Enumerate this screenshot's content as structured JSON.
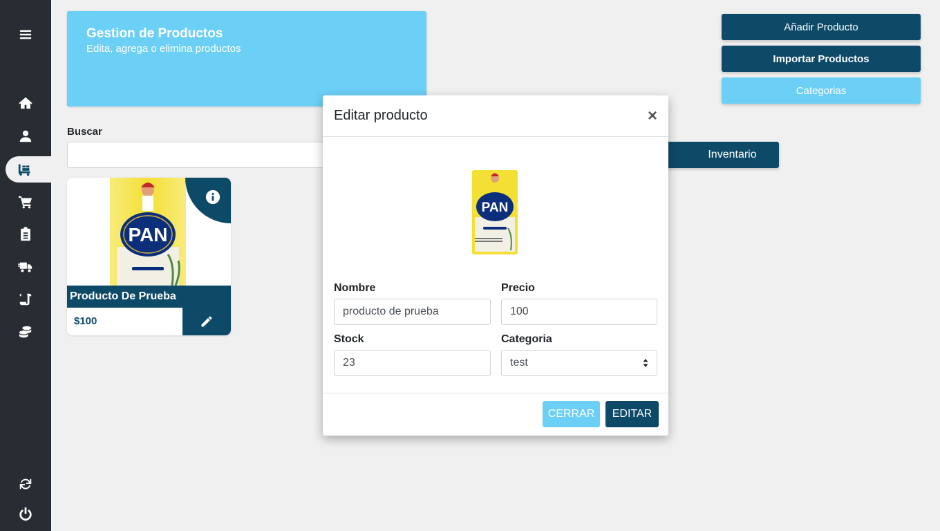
{
  "sidebar": {
    "icons": [
      "menu-icon",
      "home-icon",
      "user-icon",
      "dolly-icon",
      "cart-icon",
      "clipboard-icon",
      "truck-icon",
      "scroll-icon",
      "coins-icon",
      "sync-icon",
      "power-icon"
    ],
    "active": "dolly-icon"
  },
  "header": {
    "title": "Gestion de Productos",
    "subtitle": "Edita, agrega o elimina productos"
  },
  "actions": {
    "add_label": "Añadir Producto",
    "import_label": "Importar Productos",
    "categories_label": "Categorias"
  },
  "search": {
    "label": "Buscar",
    "value": "",
    "inventory_label": "Inventario"
  },
  "products": [
    {
      "name": "Producto De Prueba",
      "price": "$100"
    }
  ],
  "modal": {
    "title": "Editar producto",
    "close": "×",
    "fields": {
      "nombre_label": "Nombre",
      "nombre_value": "producto de prueba",
      "precio_label": "Precio",
      "precio_value": "100",
      "stock_label": "Stock",
      "stock_value": "23",
      "categoria_label": "Categoria",
      "categoria_value": "test"
    },
    "close_label": "CERRAR",
    "edit_label": "EDITAR"
  },
  "colors": {
    "sidebar_bg": "#272d33",
    "primary_dark": "#0d4a68",
    "primary_light": "#6ccff6",
    "page_bg": "#f0f0f0"
  }
}
